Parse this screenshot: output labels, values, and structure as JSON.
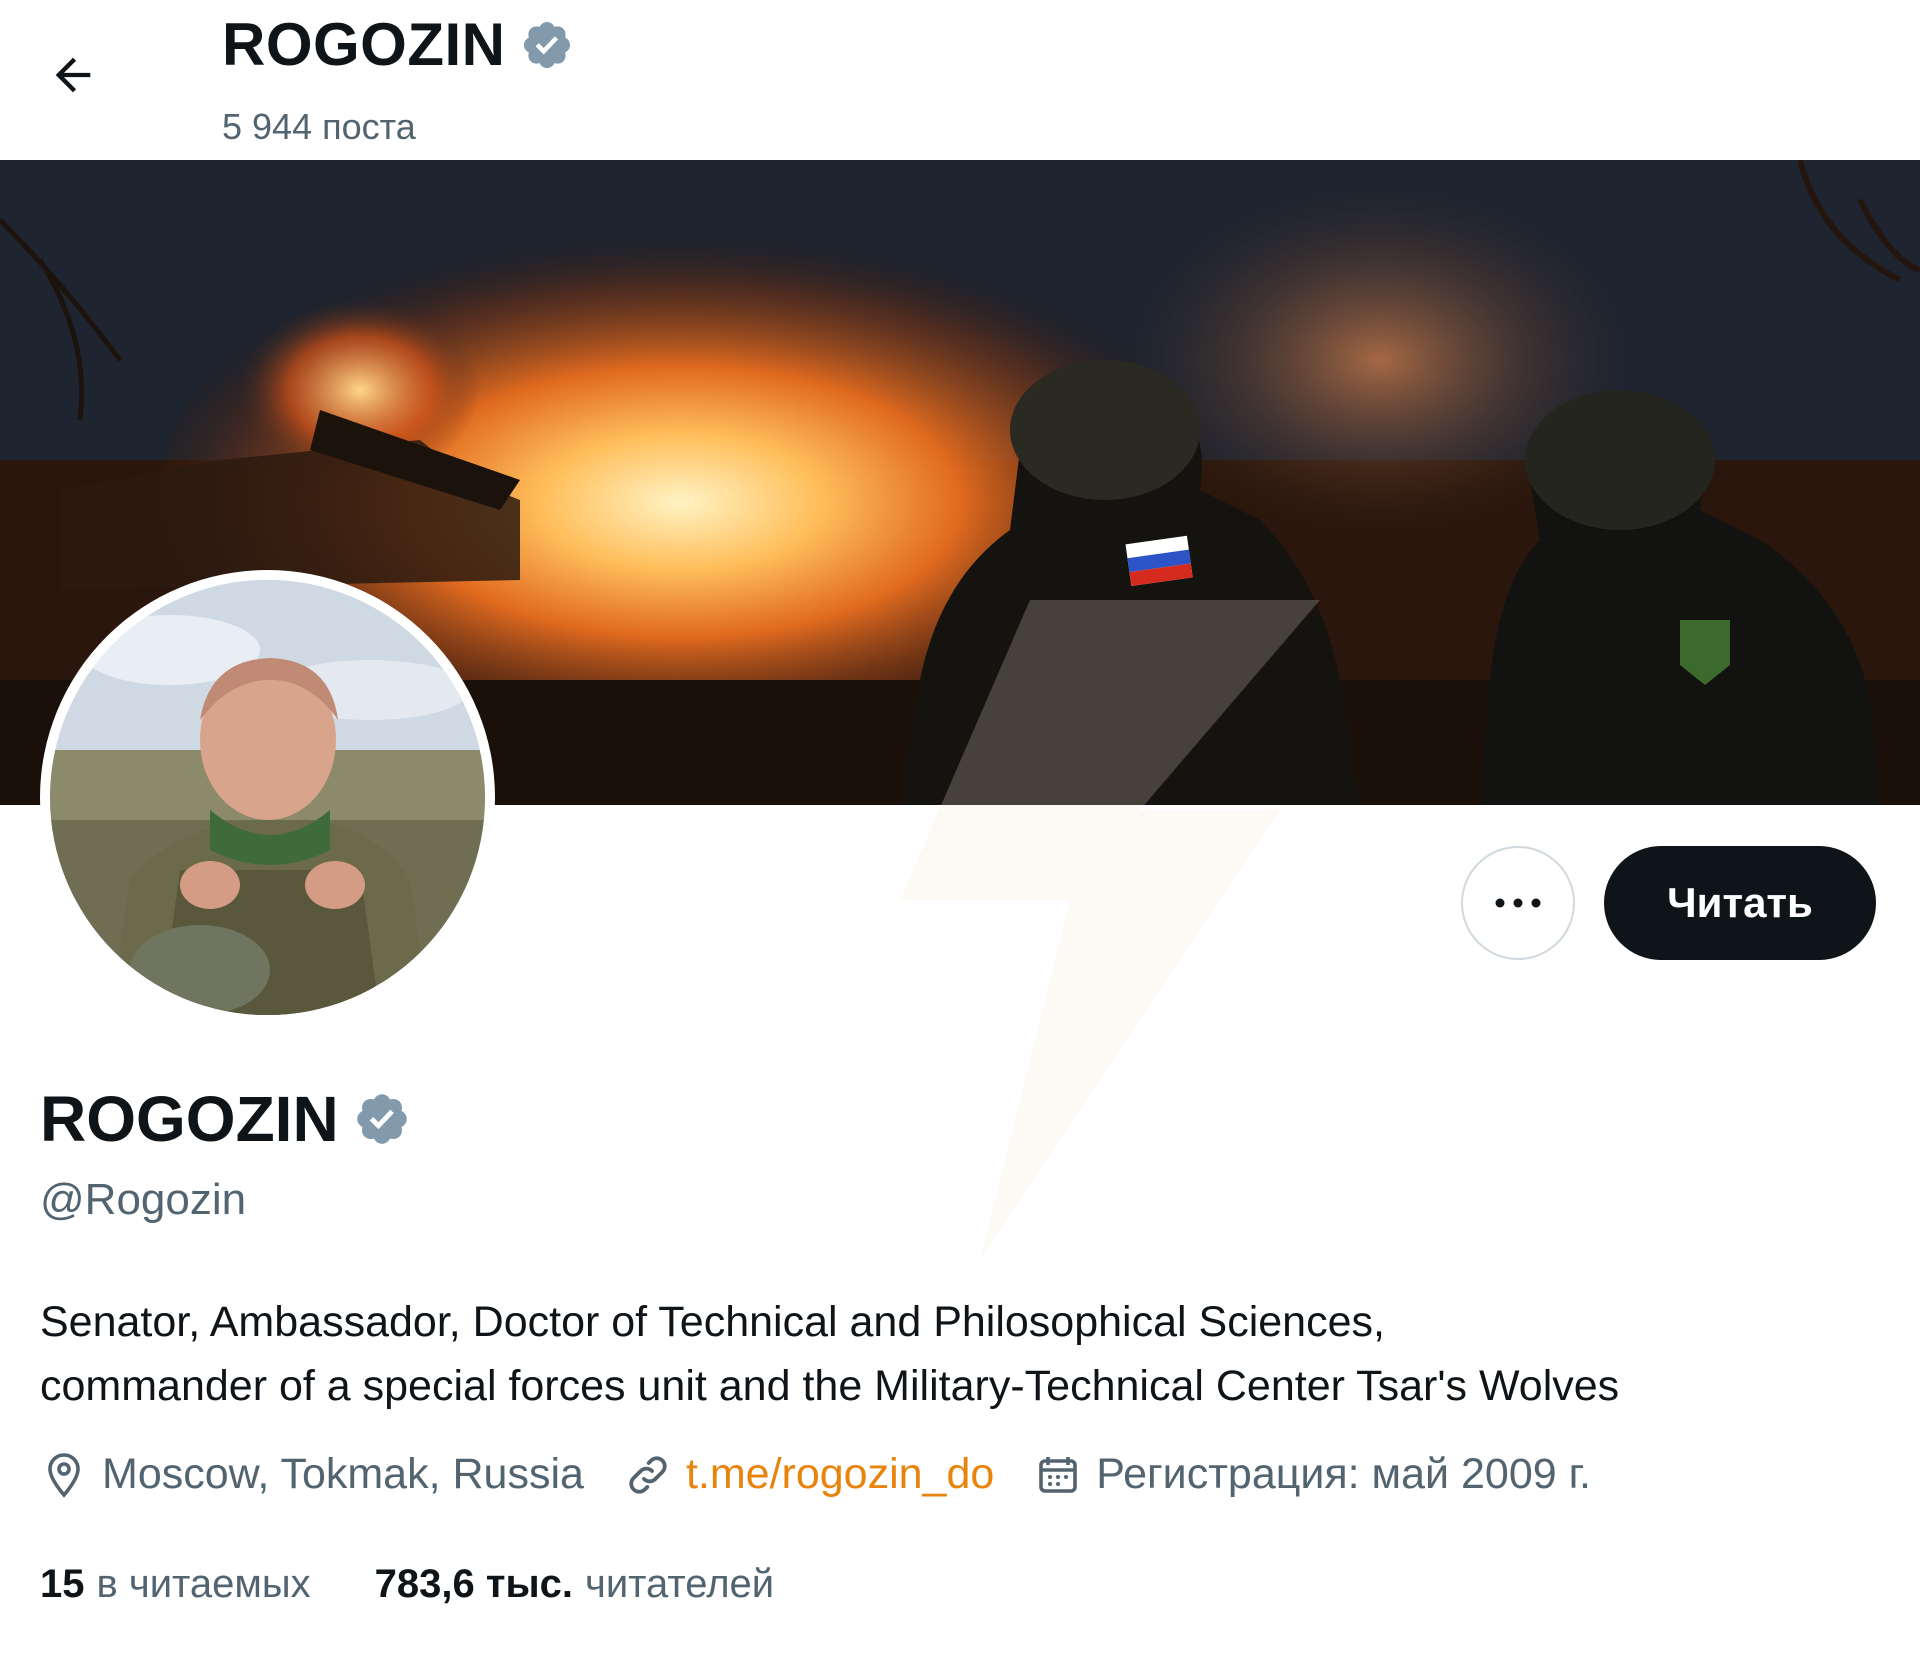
{
  "header": {
    "title": "ROGOZIN",
    "post_count": "5 944 поста"
  },
  "banner": {
    "description_icon": "banner-image",
    "flag_patch": "russia-flag"
  },
  "profile": {
    "name": "ROGOZIN",
    "handle": "@Rogozin",
    "bio_line1": "Senator, Ambassador, Doctor of Technical and Philosophical Sciences,",
    "bio_line2": "commander of a special forces unit and the Military-Technical Center Tsar's Wolves",
    "location": "Moscow, Tokmak, Russia",
    "link": "t.me/rogozin_do",
    "joined": "Регистрация: май 2009 г.",
    "following_count": "15",
    "following_label": "в читаемых",
    "followers_count": "783,6 тыс.",
    "followers_label": "читателей"
  },
  "actions": {
    "more_label": "•••",
    "follow_label": "Читать"
  },
  "colors": {
    "verified_badge": "#829aab",
    "link": "#e8830c",
    "follow_bg": "#0f1419",
    "secondary_text": "#536471"
  },
  "icons": [
    "back-arrow-icon",
    "verified-badge-icon",
    "location-icon",
    "link-icon",
    "calendar-icon",
    "more-icon"
  ]
}
